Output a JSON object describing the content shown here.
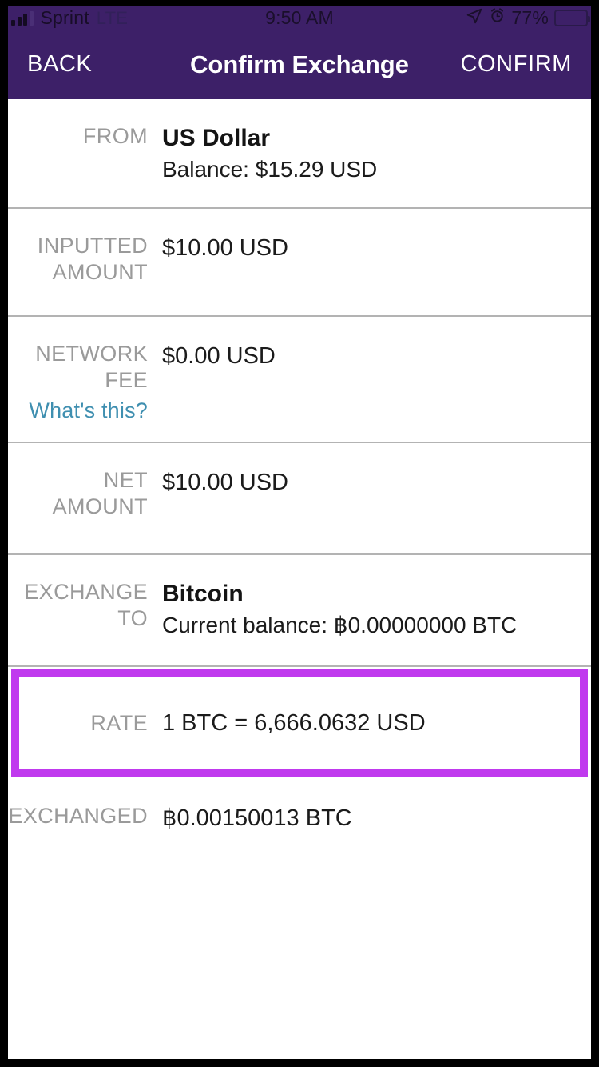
{
  "status_bar": {
    "signal_icon": "signal-bars-icon",
    "carrier": "Sprint",
    "network_type": "LTE",
    "time": "9:50 AM",
    "location_icon": "location-arrow-icon",
    "alarm_icon": "alarm-clock-icon",
    "battery_percent": "77%",
    "battery_icon": "battery-low-power-icon",
    "battery_color": "#f5d32a",
    "background_color": "#3d2068"
  },
  "nav_bar": {
    "back_label": "BACK",
    "title": "Confirm Exchange",
    "confirm_label": "CONFIRM",
    "background_color": "#3d2068",
    "text_color": "#ffffff"
  },
  "rows": {
    "from": {
      "label": "FROM",
      "currency_name": "US Dollar",
      "balance": "Balance: $15.29 USD"
    },
    "inputted_amount": {
      "label_line1": "INPUTTED",
      "label_line2": "AMOUNT",
      "value": "$10.00 USD"
    },
    "network_fee": {
      "label_line1": "NETWORK",
      "label_line2": "FEE",
      "link": "What's this?",
      "link_color": "#3f8fb0",
      "value": "$0.00 USD"
    },
    "net_amount": {
      "label_line1": "NET",
      "label_line2": "AMOUNT",
      "value": "$10.00 USD"
    },
    "exchange_to": {
      "label_line1": "EXCHANGE",
      "label_line2": "TO",
      "currency_name": "Bitcoin",
      "balance": "Current balance: ฿0.00000000 BTC"
    },
    "rate": {
      "label": "RATE",
      "value": "1 BTC = 6,666.0632 USD",
      "highlight_color": "#c03aee"
    },
    "exchanged": {
      "label": "EXCHANGED",
      "value": "฿0.00150013 BTC"
    }
  }
}
